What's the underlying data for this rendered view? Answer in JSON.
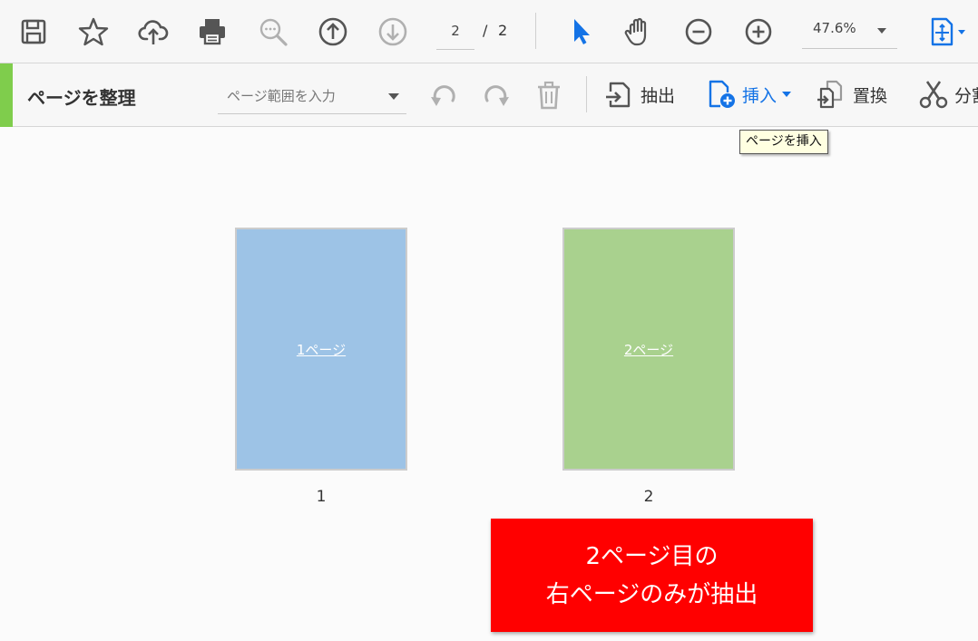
{
  "toolbar": {
    "icons": [
      "save-icon",
      "star-icon",
      "cloud-upload-icon",
      "print-icon",
      "zoom-search-icon",
      "arrow-up-icon",
      "arrow-down-icon",
      "cursor-icon",
      "hand-icon",
      "zoom-out-icon",
      "zoom-in-icon",
      "fit-page-icon"
    ],
    "page_current": "2",
    "page_separator": "/",
    "page_total": "2",
    "zoom": "47.6%"
  },
  "organize": {
    "title": "ページを整理",
    "range_placeholder": "ページ範囲を入力",
    "actions": {
      "extract": "抽出",
      "insert": "挿入",
      "replace": "置換",
      "split": "分割"
    },
    "tooltip": "ページを挿入"
  },
  "pages": [
    {
      "label": "1ページ",
      "number": "1",
      "color": "#9dc3e6"
    },
    {
      "label": "2ページ",
      "number": "2",
      "color": "#a9d18e"
    }
  ],
  "callout": {
    "line1": "2ページ目の",
    "line2": "右ページのみが抽出",
    "color": "#ff0000"
  },
  "colors": {
    "accent_green": "#7fcd4c",
    "icon_blue": "#1473e6",
    "icon_gray": "#555555",
    "icon_disabled": "#b0b0b0"
  }
}
